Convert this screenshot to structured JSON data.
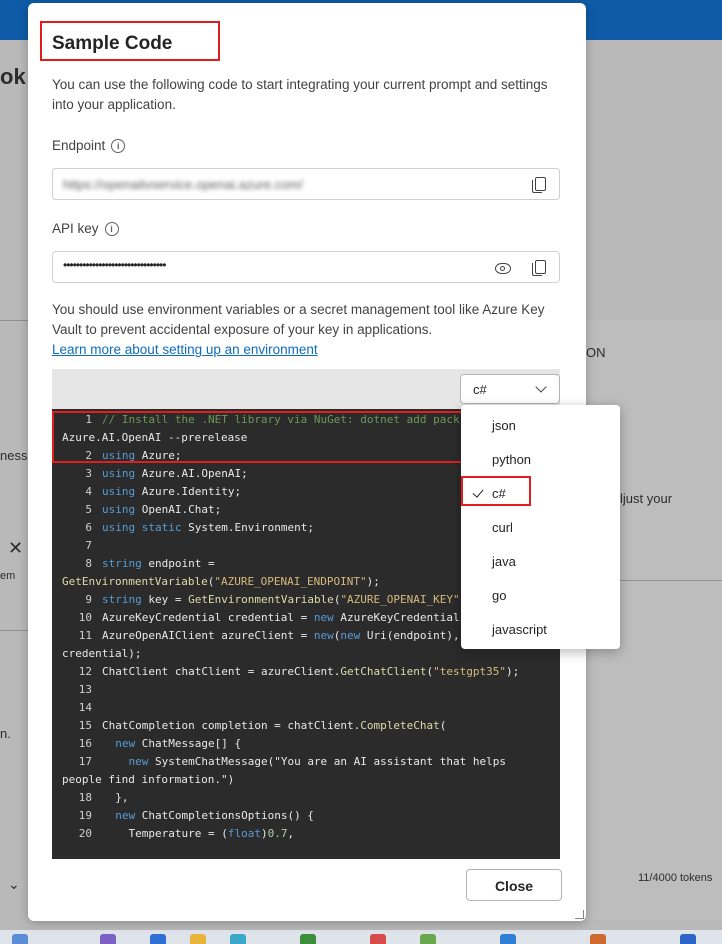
{
  "background": {
    "partial_heading": "ok",
    "partial_text_1": "ness",
    "partial_text_2": "em",
    "partial_text_3": "n.",
    "partial_right_1": "ON",
    "partial_right_2": "ljust your",
    "token_count": "11/4000 tokens"
  },
  "modal": {
    "title": "Sample Code",
    "description": "You can use the following code to start integrating your current prompt and settings into your application.",
    "endpoint_label": "Endpoint",
    "endpoint_value": "https://openaitvservice.openai.azure.com/",
    "api_key_label": "API key",
    "api_key_value": "••••••••••••••••••••••••••••••••",
    "warning": "You should use environment variables or a secret management tool like Azure Key Vault to prevent accidental exposure of your key in applications.",
    "learn_more_link": "Learn more about setting up an environment",
    "selected_language": "c#",
    "close_label": "Close"
  },
  "language_menu": {
    "options": [
      "json",
      "python",
      "c#",
      "curl",
      "java",
      "go",
      "javascript"
    ],
    "selected": "c#"
  },
  "code": {
    "lines": [
      {
        "n": "1",
        "text": "// Install the .NET library via NuGet: dotnet add pack"
      },
      {
        "n": "",
        "text": "Azure.AI.OpenAI --prerelease"
      },
      {
        "n": "2",
        "text": "using Azure;"
      },
      {
        "n": "3",
        "text": "using Azure.AI.OpenAI;"
      },
      {
        "n": "4",
        "text": "using Azure.Identity;"
      },
      {
        "n": "5",
        "text": "using OpenAI.Chat;"
      },
      {
        "n": "6",
        "text": "using static System.Environment;"
      },
      {
        "n": "7",
        "text": ""
      },
      {
        "n": "8",
        "text": "string endpoint ="
      },
      {
        "n": "",
        "text": "GetEnvironmentVariable(\"AZURE_OPENAI_ENDPOINT\");"
      },
      {
        "n": "9",
        "text": "string key = GetEnvironmentVariable(\"AZURE_OPENAI_KEY\""
      },
      {
        "n": "10",
        "text": "AzureKeyCredential credential = new AzureKeyCredentiali"
      },
      {
        "n": "11",
        "text": "AzureOpenAIClient azureClient = new(new Uri(endpoint),"
      },
      {
        "n": "",
        "text": "credential);"
      },
      {
        "n": "12",
        "text": "ChatClient chatClient = azureClient.GetChatClient(\"testgpt35\");"
      },
      {
        "n": "13",
        "text": ""
      },
      {
        "n": "14",
        "text": ""
      },
      {
        "n": "15",
        "text": "ChatCompletion completion = chatClient.CompleteChat("
      },
      {
        "n": "16",
        "text": "  new ChatMessage[] {"
      },
      {
        "n": "17",
        "text": "    new SystemChatMessage(\"You are an AI assistant that helps"
      },
      {
        "n": "",
        "text": "people find information.\")"
      },
      {
        "n": "18",
        "text": "  },"
      },
      {
        "n": "19",
        "text": "  new ChatCompletionsOptions() {"
      },
      {
        "n": "20",
        "text": "    Temperature = (float)0.7,"
      }
    ]
  }
}
